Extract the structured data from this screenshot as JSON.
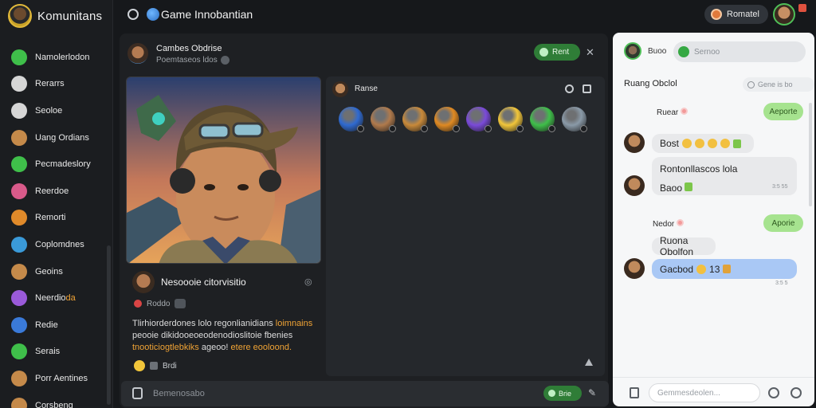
{
  "app": {
    "title": "Komunitans"
  },
  "sidebar": {
    "items": [
      {
        "label": "Namolerlodon",
        "icon": "green-chat-icon",
        "color": "#3fbf4a"
      },
      {
        "label": "Rerarrs",
        "icon": "monitor-icon",
        "color": "#d6d6d6"
      },
      {
        "label": "Seoloe",
        "icon": "square-icon",
        "color": "#d6d6d6"
      },
      {
        "label": "Uang Ordians",
        "icon": "avatar-icon",
        "color": "#c58a4a"
      },
      {
        "label": "Pecmadeslory",
        "icon": "green-chat-icon",
        "color": "#3fbf4a"
      },
      {
        "label": "Reerdoe",
        "icon": "gem-icon",
        "color": "#d95a8a"
      },
      {
        "label": "Remorti",
        "icon": "fire-icon",
        "color": "#e08a2a"
      },
      {
        "label": "Coplomdnes",
        "icon": "planet-icon",
        "color": "#3a9ad9"
      },
      {
        "label": "Geoins",
        "icon": "avatar-icon",
        "color": "#c58a4a"
      },
      {
        "label": "Neerdio",
        "label_highlight": "da",
        "icon": "magic-icon",
        "color": "#9a5ad9"
      },
      {
        "label": "Redie",
        "icon": "globe-icon",
        "color": "#3a7ad9"
      },
      {
        "label": "Serais",
        "icon": "leaf-icon",
        "color": "#3fbf4a"
      },
      {
        "label": "Porr Aentines",
        "icon": "avatar-icon",
        "color": "#c58a4a"
      },
      {
        "label": "Corsbeng",
        "icon": "avatar-icon",
        "color": "#c58a4a"
      }
    ]
  },
  "header": {
    "title": "Game Innobantian",
    "pill_label": "Romatel"
  },
  "main": {
    "profile": {
      "name": "Cambes Obdrise",
      "sub": "Poemtaseos ldos"
    },
    "follow_button": "Rent",
    "post": {
      "title": "Nesoooie citorvisitio",
      "meta": "Roddo",
      "body_1": "Tlirhiorderdones lolo regonlianidians ",
      "body_1_hl": "loimnains",
      "body_2": "peooie dikidooeoeodenodioslitoie fbenies",
      "body_3_hl": "tnooticiogtlebkiks",
      "body_3": " ageoo! ",
      "body_3_hl2": "etere eooloond.",
      "reacts": "Brdi"
    },
    "emotes": {
      "label": "Ranse",
      "items": [
        {
          "icon": "blue-crystal-icon",
          "color": "#2f6ad1"
        },
        {
          "icon": "warrior-face-icon",
          "color": "#b07a4c"
        },
        {
          "icon": "sword-icon",
          "color": "#c98a3a"
        },
        {
          "icon": "fireball-icon",
          "color": "#e08a22"
        },
        {
          "icon": "mage-face-icon",
          "color": "#7a4ad9"
        },
        {
          "icon": "smile-face-icon",
          "color": "#f2c63a"
        },
        {
          "icon": "green-orb-icon",
          "color": "#3fbf4a"
        },
        {
          "icon": "skull-face-icon",
          "color": "#8a9aa8"
        }
      ]
    },
    "composer": {
      "placeholder": "Bemenosabo",
      "send_label": "Brie"
    }
  },
  "chat": {
    "user": "Buoo",
    "search_placeholder": "Sernoo",
    "title": "Ruang Obclol",
    "filter_label": "Gene is bo",
    "messages": [
      {
        "text": "Ruear",
        "reply": "Aeporte"
      },
      {
        "text": "Bost"
      },
      {
        "text_1": "Rontonllascos lola",
        "text_2": "Baoo",
        "time": "3:5 55"
      },
      {
        "text": "Nedor",
        "reply": "Aporie"
      },
      {
        "text": "Ruona Obolfon"
      },
      {
        "text": "Gacbod",
        "emoji_count": "13",
        "time": "3:5 5"
      }
    ],
    "composer_placeholder": "Gemmesdeolen..."
  }
}
